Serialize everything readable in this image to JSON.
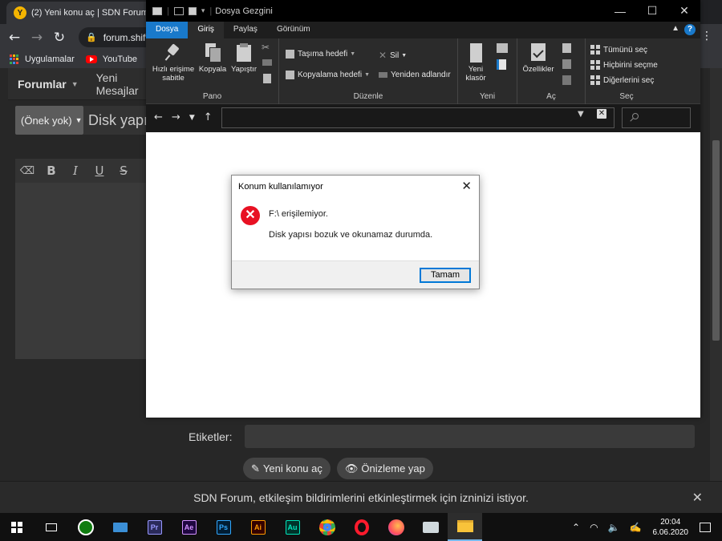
{
  "browser": {
    "tab_title": "(2) Yeni konu aç | SDN Forum",
    "tab_favicon": "Y",
    "url": "forum.shift",
    "bookmarks": [
      {
        "label": "Uygulamalar",
        "icon": "apps-icon"
      },
      {
        "label": "YouTube",
        "icon": "youtube-icon"
      }
    ]
  },
  "forum": {
    "nav_forums": "Forumlar",
    "nav_new_posts": "Yeni Mesajlar",
    "prefix_select": "(Önek yok)",
    "title_placeholder": "Disk yapısı bozuk",
    "editor_tools": [
      "eraser-icon",
      "bold-icon",
      "italic-icon",
      "underline-icon",
      "strikethrough-icon"
    ],
    "tags_label": "Etiketler:",
    "submit_button": "Yeni konu aç",
    "preview_button": "Önizleme yap",
    "notification_text": "SDN Forum, etkileşim bildirimlerini etkinleştirmek için izninizi istiyor."
  },
  "explorer": {
    "window_title": "Dosya Gezgini",
    "ribbon_tabs": [
      "Dosya",
      "Giriş",
      "Paylaş",
      "Görünüm"
    ],
    "active_tab": "Giriş",
    "groups": {
      "pano": {
        "label": "Pano",
        "pin": "Hızlı erişime sabitle",
        "copy": "Kopyala",
        "paste": "Yapıştır"
      },
      "duzenle": {
        "label": "Düzenle",
        "move_to": "Taşıma hedefi",
        "copy_to": "Kopyalama hedefi",
        "delete": "Sil",
        "rename": "Yeniden adlandır"
      },
      "yeni": {
        "label": "Yeni",
        "new_folder": "Yeni klasör"
      },
      "ac": {
        "label": "Aç",
        "properties": "Özellikler"
      },
      "sec": {
        "label": "Seç",
        "select_all": "Tümünü seç",
        "select_none": "Hiçbirini seçme",
        "invert": "Diğerlerini seç"
      }
    },
    "address_value": ""
  },
  "dialog": {
    "title": "Konum kullanılamıyor",
    "message_primary": "F:\\ erişilemiyor.",
    "message_secondary": "Disk yapısı bozuk ve okunamaz durumda.",
    "ok_button": "Tamam"
  },
  "taskbar": {
    "apps": [
      {
        "name": "task-view-icon",
        "label": ""
      },
      {
        "name": "xbox-icon",
        "label": ""
      },
      {
        "name": "laptop-icon",
        "label": ""
      },
      {
        "name": "premiere-icon",
        "label": "Pr",
        "color": "#2a2a5a",
        "text": "#9999ff"
      },
      {
        "name": "after-effects-icon",
        "label": "Ae",
        "color": "#1f0740",
        "text": "#d291ff"
      },
      {
        "name": "photoshop-icon",
        "label": "Ps",
        "color": "#001d34",
        "text": "#31a8ff"
      },
      {
        "name": "illustrator-icon",
        "label": "Ai",
        "color": "#330000",
        "text": "#ff9a00"
      },
      {
        "name": "audition-icon",
        "label": "Au",
        "color": "#00332a",
        "text": "#00e4bb"
      },
      {
        "name": "chrome-icon",
        "label": ""
      },
      {
        "name": "opera-icon",
        "label": ""
      },
      {
        "name": "firefox-icon",
        "label": ""
      },
      {
        "name": "control-panel-icon",
        "label": ""
      },
      {
        "name": "file-explorer-icon",
        "label": ""
      }
    ],
    "time": "20:04",
    "date": "6.06.2020"
  }
}
